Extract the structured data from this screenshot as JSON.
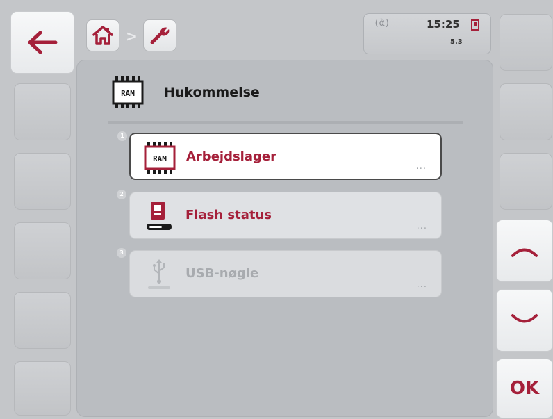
{
  "navigation": {
    "back": {
      "icon": "arrow-left-icon"
    },
    "breadcrumb": [
      {
        "icon": "home-icon"
      },
      {
        "icon": "wrench-icon"
      }
    ],
    "separator": ">"
  },
  "status": {
    "time": "15:25",
    "version": "5.3",
    "signal_icon": "antenna-icon",
    "storage_icon": "memory-card-icon"
  },
  "page": {
    "title": "Hukommelse",
    "icon": "ram-chip-icon"
  },
  "items": [
    {
      "number": "1",
      "label": "Arbejdslager",
      "icon": "ram-chip-icon",
      "more": "...",
      "state": "selected"
    },
    {
      "number": "2",
      "label": "Flash status",
      "icon": "flash-storage-icon",
      "more": "...",
      "state": "enabled"
    },
    {
      "number": "3",
      "label": "USB-nøgle",
      "icon": "usb-icon",
      "more": "...",
      "state": "disabled"
    }
  ],
  "right_buttons": {
    "up": {
      "icon": "chevron-up-icon"
    },
    "down": {
      "icon": "chevron-down-icon"
    },
    "ok": {
      "label": "OK"
    }
  },
  "colors": {
    "accent": "#a5203a",
    "background": "#c4c6c9",
    "panel": "#babdc1"
  }
}
